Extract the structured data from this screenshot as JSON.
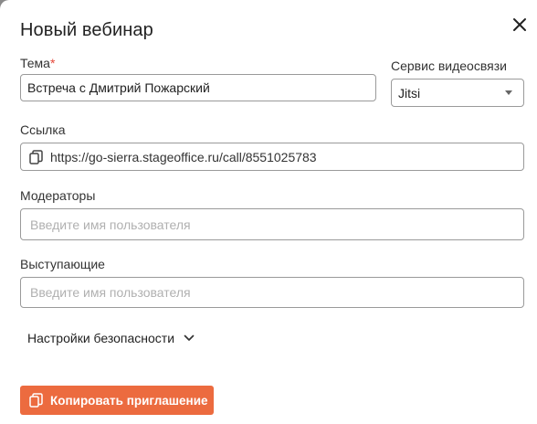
{
  "dialog": {
    "title": "Новый вебинар",
    "close_icon": "close-icon"
  },
  "topic": {
    "label": "Тема",
    "required_mark": "*",
    "value": "Встреча с Дмитрий Пожарский"
  },
  "video_service": {
    "label": "Сервис видеосвязи",
    "selected": "Jitsi"
  },
  "link": {
    "label": "Ссылка",
    "value": "https://go-sierra.stageoffice.ru/call/8551025783",
    "icon": "copy-icon"
  },
  "moderators": {
    "label": "Модераторы",
    "placeholder": "Введите имя пользователя"
  },
  "speakers": {
    "label": "Выступающие",
    "placeholder": "Введите имя пользователя"
  },
  "security": {
    "label": "Настройки безопасности",
    "icon": "chevron-down-icon"
  },
  "copy_button": {
    "label": "Копировать приглашение",
    "icon": "copy-icon",
    "color": "#ec6b3f"
  },
  "colors": {
    "required": "#e5483a",
    "border": "#9a9a9a"
  }
}
